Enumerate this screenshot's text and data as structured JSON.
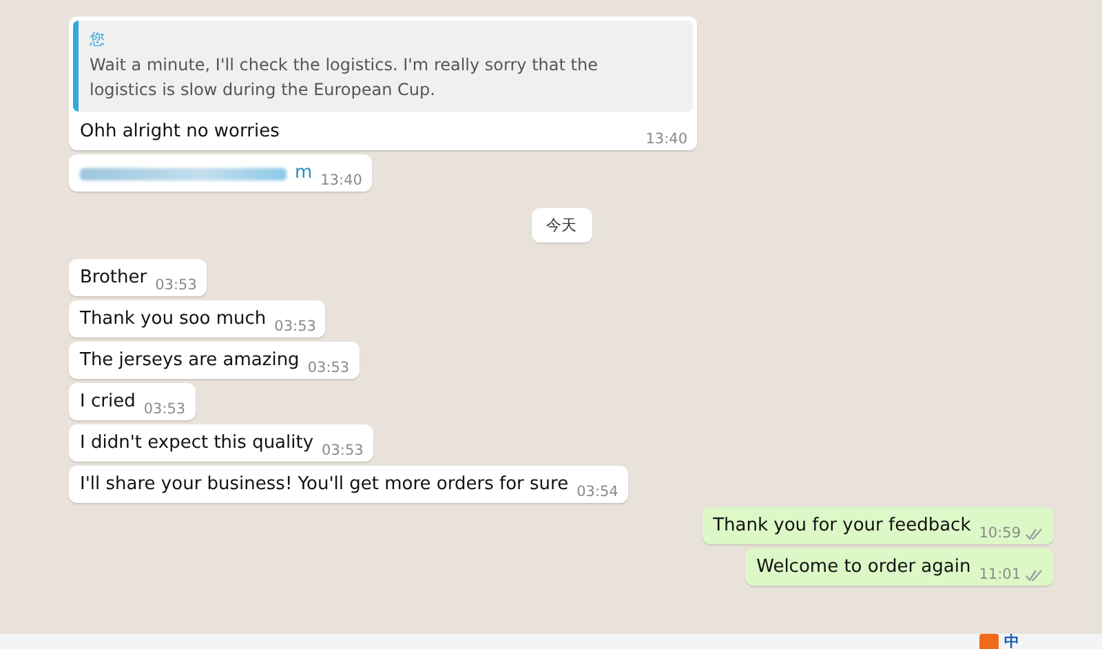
{
  "messages": [
    {
      "kind": "quote",
      "outgoing": false,
      "quote_author": "您",
      "quote_text": "Wait a minute, I'll check the logistics. I'm really sorry that the logistics is slow during the European Cup.",
      "text": "Ohh alright no worries",
      "time": "13:40"
    },
    {
      "kind": "redacted",
      "outgoing": false,
      "text": "m",
      "time": "13:40"
    },
    {
      "kind": "date",
      "text": "今天"
    },
    {
      "kind": "text",
      "outgoing": false,
      "text": "Brother",
      "time": "03:53"
    },
    {
      "kind": "text",
      "outgoing": false,
      "text": "Thank you soo much",
      "time": "03:53"
    },
    {
      "kind": "text",
      "outgoing": false,
      "text": "The jerseys are amazing",
      "time": "03:53"
    },
    {
      "kind": "text",
      "outgoing": false,
      "text": "I cried",
      "time": "03:53"
    },
    {
      "kind": "text",
      "outgoing": false,
      "text": "I didn't expect this quality",
      "time": "03:53"
    },
    {
      "kind": "text",
      "outgoing": false,
      "text": "I'll share your business! You'll get more orders for sure",
      "time": "03:54"
    },
    {
      "kind": "text",
      "outgoing": true,
      "text": "Thank you for your feedback",
      "time": "10:59",
      "delivered": true
    },
    {
      "kind": "text",
      "outgoing": true,
      "text": "Welcome to order again",
      "time": "11:01",
      "delivered": true
    }
  ],
  "ime_bar": {
    "mode": "中"
  }
}
